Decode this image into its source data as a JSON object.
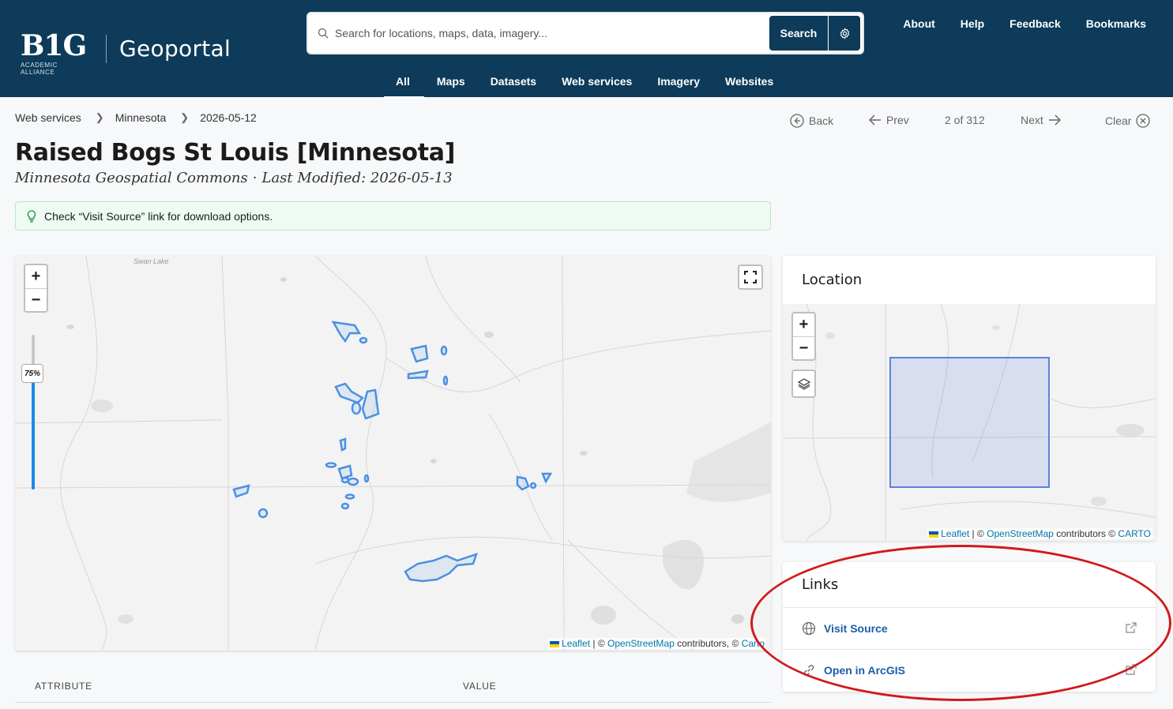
{
  "header": {
    "logo_text": "B1G",
    "logo_sub": "ACADEMIC ALLIANCE",
    "brand": "Geoportal",
    "search": {
      "placeholder": "Search for locations, maps, data, imagery...",
      "button_label": "Search"
    },
    "topnav": [
      "About",
      "Help",
      "Feedback",
      "Bookmarks"
    ],
    "tabs": [
      {
        "label": "All",
        "active": true
      },
      {
        "label": "Maps"
      },
      {
        "label": "Datasets"
      },
      {
        "label": "Web services"
      },
      {
        "label": "Imagery"
      },
      {
        "label": "Websites"
      }
    ]
  },
  "breadcrumb": [
    "Web services",
    "Minnesota",
    "2026-05-12"
  ],
  "result_nav": {
    "back": "Back",
    "prev": "Prev",
    "position": "2 of 312",
    "next": "Next",
    "clear": "Clear"
  },
  "record": {
    "title": "Raised Bogs St Louis [Minnesota]",
    "publisher": "Minnesota Geospatial Commons",
    "modified": "Last Modified: 2026-05-13",
    "notice": "Check “Visit Source” link for download options."
  },
  "map": {
    "opacity_label": "75%",
    "opacity_value": 0.75,
    "place_label": "Swan Lake",
    "attribution": {
      "leaflet": "Leaflet",
      "osm": "OpenStreetMap",
      "contributors": "contributors, ©",
      "carto": "Carto"
    }
  },
  "location": {
    "title": "Location",
    "attribution": {
      "leaflet": "Leaflet",
      "osm": "OpenStreetMap",
      "contributors": "contributors ©",
      "carto": "CARTO"
    }
  },
  "links": {
    "title": "Links",
    "items": [
      {
        "label": "Visit Source",
        "icon": "globe-icon"
      },
      {
        "label": "Open in ArcGIS",
        "icon": "link-icon"
      }
    ]
  },
  "table": {
    "col_attribute": "ATTRIBUTE",
    "col_value": "VALUE"
  },
  "colors": {
    "header_bg": "#0d3b59",
    "polygon_stroke": "#4a90e2",
    "annotation": "#d11a1a"
  }
}
